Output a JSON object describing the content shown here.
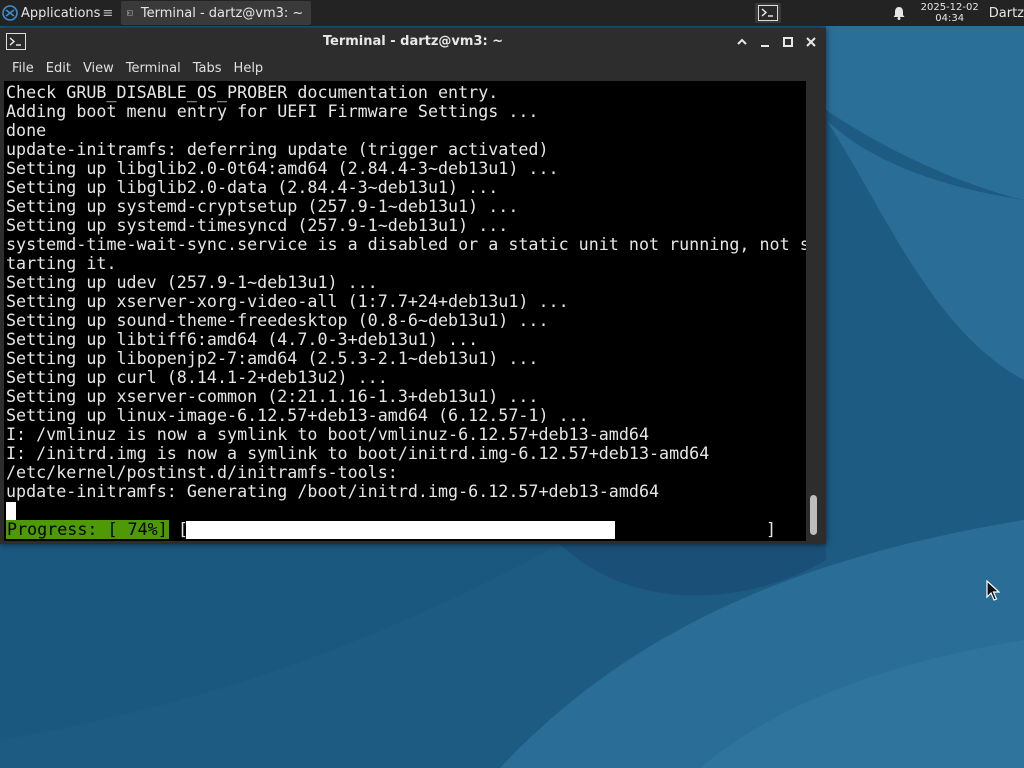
{
  "panel": {
    "applications_label": "Applications",
    "applications_suffix": "≡",
    "task_title": "Terminal - dartz@vm3: ~",
    "clock_date": "2025-12-02",
    "clock_time": "04:34",
    "user": "Dartz"
  },
  "window": {
    "title": "Terminal - dartz@vm3: ~",
    "menu": [
      "File",
      "Edit",
      "View",
      "Terminal",
      "Tabs",
      "Help"
    ]
  },
  "terminal": {
    "lines": [
      "Check GRUB_DISABLE_OS_PROBER documentation entry.",
      "Adding boot menu entry for UEFI Firmware Settings ...",
      "done",
      "update-initramfs: deferring update (trigger activated)",
      "Setting up libglib2.0-0t64:amd64 (2.84.4-3~deb13u1) ...",
      "Setting up libglib2.0-data (2.84.4-3~deb13u1) ...",
      "Setting up systemd-cryptsetup (257.9-1~deb13u1) ...",
      "Setting up systemd-timesyncd (257.9-1~deb13u1) ...",
      "systemd-time-wait-sync.service is a disabled or a static unit not running, not s",
      "tarting it.",
      "Setting up udev (257.9-1~deb13u1) ...",
      "Setting up xserver-xorg-video-all (1:7.7+24+deb13u1) ...",
      "Setting up sound-theme-freedesktop (0.8-6~deb13u1) ...",
      "Setting up libtiff6:amd64 (4.7.0-3+deb13u1) ...",
      "Setting up libopenjp2-7:amd64 (2.5.3-2.1~deb13u1) ...",
      "Setting up curl (8.14.1-2+deb13u2) ...",
      "Setting up xserver-common (2:21.1.16-1.3+deb13u1) ...",
      "Setting up linux-image-6.12.57+deb13-amd64 (6.12.57-1) ...",
      "I: /vmlinuz is now a symlink to boot/vmlinuz-6.12.57+deb13-amd64",
      "I: /initrd.img is now a symlink to boot/initrd.img-6.12.57+deb13-amd64",
      "/etc/kernel/postinst.d/initramfs-tools:",
      "update-initramfs: Generating /boot/initrd.img-6.12.57+deb13-amd64"
    ],
    "progress_label": "Progress: [ 74%]",
    "progress_open": "[",
    "progress_close": "]",
    "progress_fraction": 0.74
  },
  "colors": {
    "desktop_bg": "#1e5f86",
    "panel_bg": "#232323",
    "terminal_bg": "#000000",
    "progress_label_bg": "#4e9a06"
  }
}
